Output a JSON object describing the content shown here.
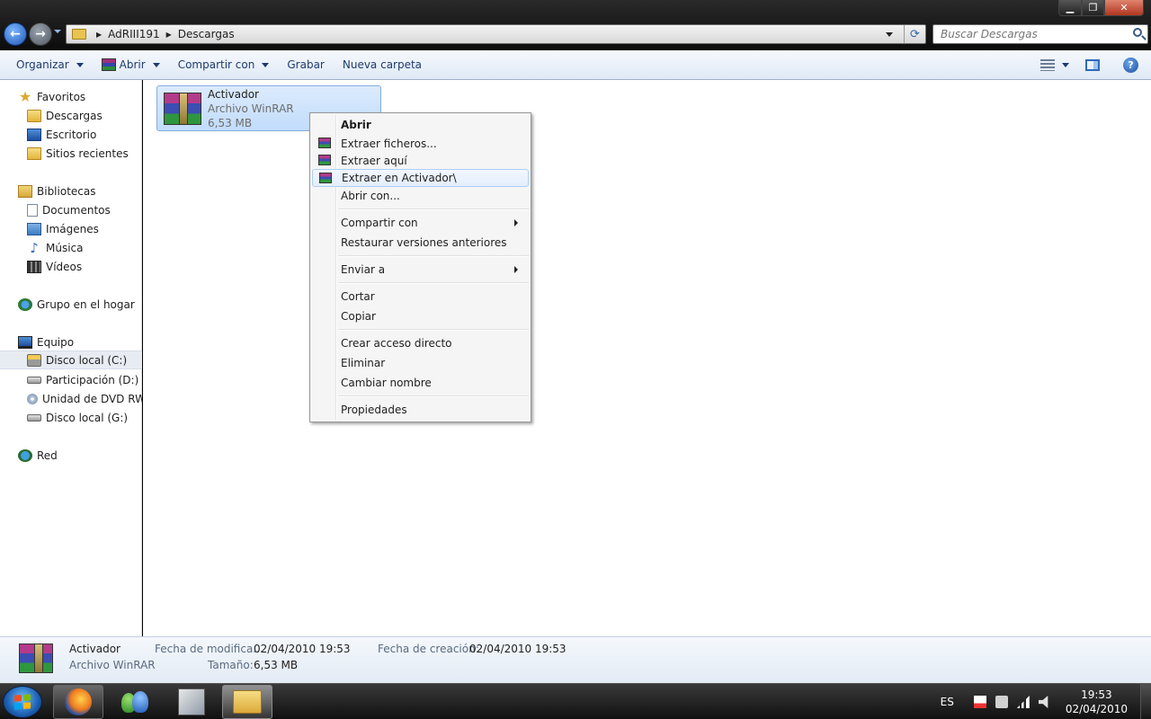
{
  "window": {
    "path": [
      "AdRIII191",
      "Descargas"
    ],
    "search_placeholder": "Buscar Descargas"
  },
  "toolbar": {
    "organize": "Organizar",
    "open": "Abrir",
    "share": "Compartir con",
    "burn": "Grabar",
    "new_folder": "Nueva carpeta",
    "help": "?"
  },
  "nav": {
    "favorites": "Favoritos",
    "downloads": "Descargas",
    "desktop": "Escritorio",
    "recent": "Sitios recientes",
    "libraries": "Bibliotecas",
    "documents": "Documentos",
    "images": "Imágenes",
    "music": "Música",
    "videos": "Vídeos",
    "homegroup": "Grupo en el hogar",
    "computer": "Equipo",
    "drive_c": "Disco local (C:)",
    "drive_d": "Participación (D:)",
    "drive_dvd": "Unidad de DVD RW (",
    "drive_g": "Disco local (G:)",
    "network": "Red"
  },
  "file": {
    "name": "Activador",
    "type": "Archivo WinRAR",
    "size": "6,53 MB"
  },
  "context_menu": {
    "open": "Abrir",
    "extract_files": "Extraer ficheros...",
    "extract_here": "Extraer aquí",
    "extract_to": "Extraer en Activador\\",
    "open_with": "Abrir con...",
    "share_with": "Compartir con",
    "restore": "Restaurar versiones anteriores",
    "send_to": "Enviar a",
    "cut": "Cortar",
    "copy": "Copiar",
    "create_shortcut": "Crear acceso directo",
    "delete": "Eliminar",
    "rename": "Cambiar nombre",
    "properties": "Propiedades"
  },
  "details": {
    "name": "Activador",
    "type": "Archivo WinRAR",
    "modified_label": "Fecha de modifica...",
    "modified_value": "02/04/2010 19:53",
    "size_label": "Tamaño:",
    "size_value": "6,53 MB",
    "created_label": "Fecha de creación:",
    "created_value": "02/04/2010 19:53"
  },
  "taskbar": {
    "language": "ES",
    "time": "19:53",
    "date": "02/04/2010"
  }
}
